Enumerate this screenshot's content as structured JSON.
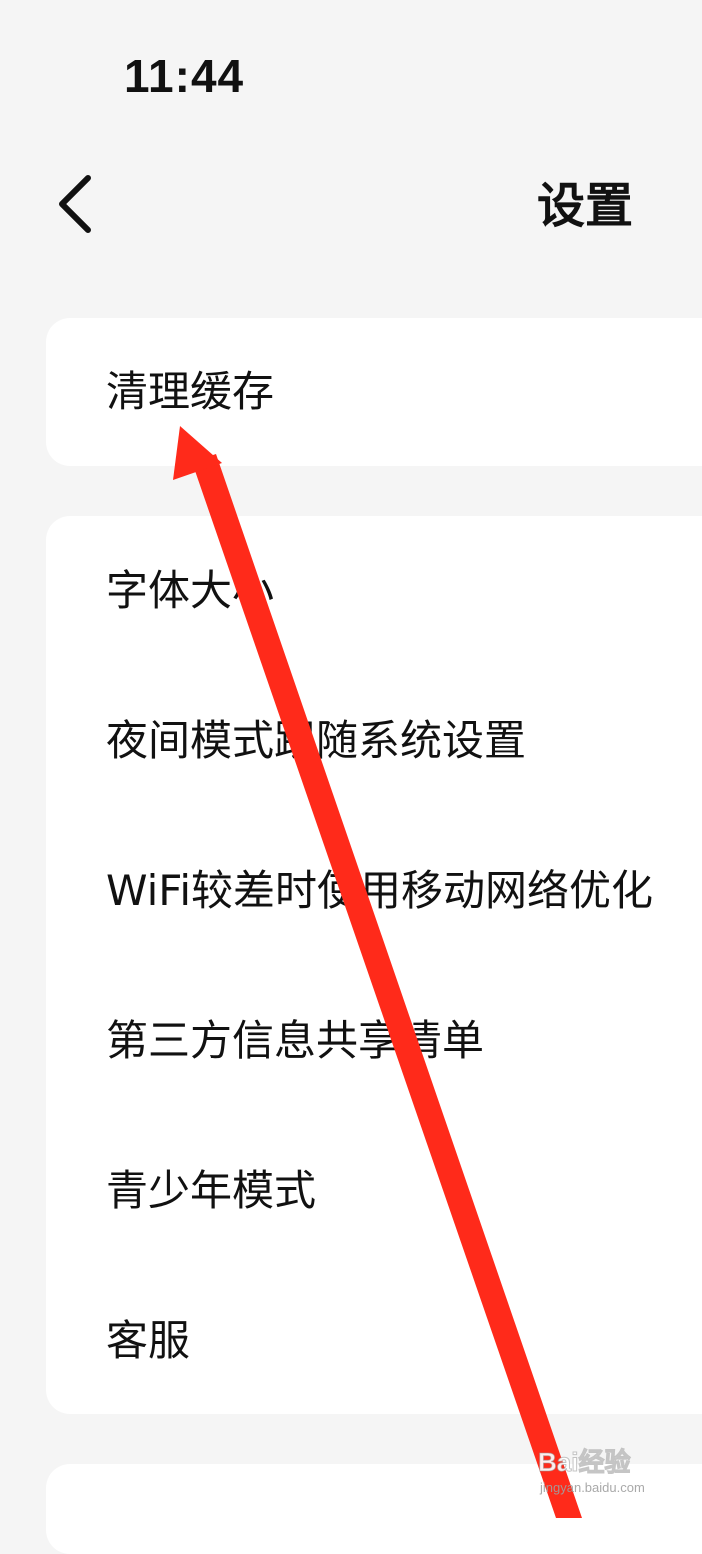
{
  "status_bar": {
    "time": "11:44"
  },
  "header": {
    "back_icon": "chevron-left-icon",
    "title": "设置"
  },
  "cache_group": {
    "items": [
      {
        "label": "清理缓存"
      }
    ]
  },
  "main_group": {
    "items": [
      {
        "label": "字体大小"
      },
      {
        "label": "夜间模式跟随系统设置"
      },
      {
        "label": "WiFi较差时使用移动网络优化"
      },
      {
        "label": "第三方信息共享清单"
      },
      {
        "label": "青少年模式"
      },
      {
        "label": "客服"
      }
    ]
  },
  "annotation": {
    "arrow_color": "#ff2a1a",
    "arrow_points_to": "清理缓存"
  },
  "watermark": {
    "main_text": "Bai经验",
    "sub_text": "jingyan.baidu.com"
  },
  "colors": {
    "background": "#f5f5f5",
    "card": "#ffffff",
    "text": "#111111"
  }
}
